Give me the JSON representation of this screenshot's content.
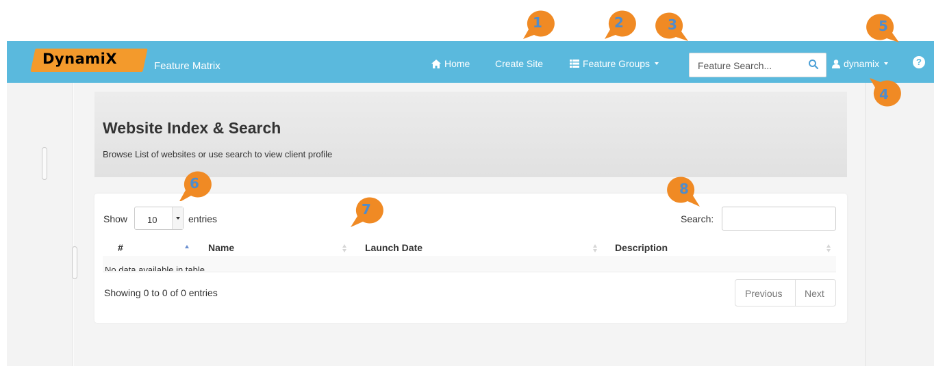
{
  "navbar": {
    "logo_text": "DynamiX",
    "brand_subtitle": "Feature Matrix",
    "home_label": "Home",
    "create_site_label": "Create Site",
    "feature_groups_label": "Feature Groups",
    "search_placeholder": "Feature Search...",
    "user_label": "dynamix",
    "help_icon": "?"
  },
  "hero": {
    "title": "Website Index & Search",
    "subtitle": "Browse List of websites or use search to view client profile"
  },
  "table_controls": {
    "show_label": "Show",
    "entries_value": "10",
    "entries_label": "entries",
    "search_label": "Search:"
  },
  "table": {
    "columns": [
      "#",
      "Name",
      "Launch Date",
      "Description"
    ],
    "empty_message": "No data available in table",
    "info": "Showing 0 to 0 of 0 entries"
  },
  "pagination": {
    "previous_label": "Previous",
    "next_label": "Next"
  },
  "markers": [
    "1",
    "2",
    "3",
    "4",
    "5",
    "6",
    "7",
    "8"
  ],
  "colors": {
    "navbar": "#5ab9dd",
    "logo_orange": "#f39a2c",
    "marker_orange": "#f08a24",
    "marker_number": "#4f8ccc"
  }
}
